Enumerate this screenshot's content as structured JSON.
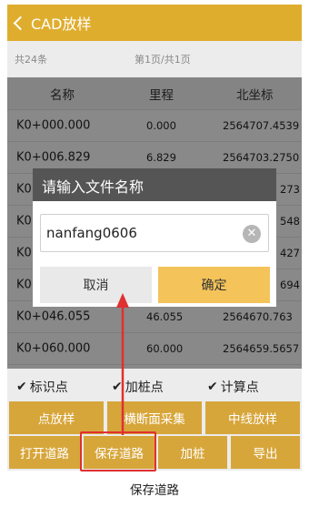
{
  "app": {
    "title": "CAD放样"
  },
  "paging": {
    "total": "共24条",
    "pages": "第1页/共1页"
  },
  "table": {
    "headers": [
      "名称",
      "里程",
      "北坐标"
    ],
    "rows": [
      [
        "K0+000.000",
        "0.000",
        "2564707.4539"
      ],
      [
        "K0+006.829",
        "6.829",
        "2564703.2750"
      ],
      [
        "K0",
        "",
        "273"
      ],
      [
        "K0",
        "",
        "548"
      ],
      [
        "K0",
        "",
        "427"
      ],
      [
        "K0",
        "",
        "694"
      ],
      [
        "K0+046.055",
        "46.055",
        "2564670.763"
      ],
      [
        "K0+060.000",
        "60.000",
        "2564659.5657"
      ]
    ]
  },
  "dialog": {
    "title": "请输入文件名称",
    "input_value": "nanfang0606",
    "cancel": "取消",
    "confirm": "确定"
  },
  "checkboxes": [
    {
      "label": "标识点",
      "checked": true
    },
    {
      "label": "加桩点",
      "checked": true
    },
    {
      "label": "计算点",
      "checked": true
    }
  ],
  "buttons_row1": [
    "点放样",
    "横断面采集",
    "中线放样"
  ],
  "buttons_row2": [
    "打开道路",
    "保存道路",
    "加桩",
    "导出"
  ],
  "caption": "保存道路",
  "colors": {
    "accent": "#dfad2e",
    "button": "#d7a63a",
    "confirm": "#f4c35a",
    "highlight": "#e03030"
  },
  "icons": {
    "back": "chevron-left-icon",
    "clear": "clear-icon",
    "check": "checkmark-icon",
    "annotation": "arrow-up-icon"
  }
}
